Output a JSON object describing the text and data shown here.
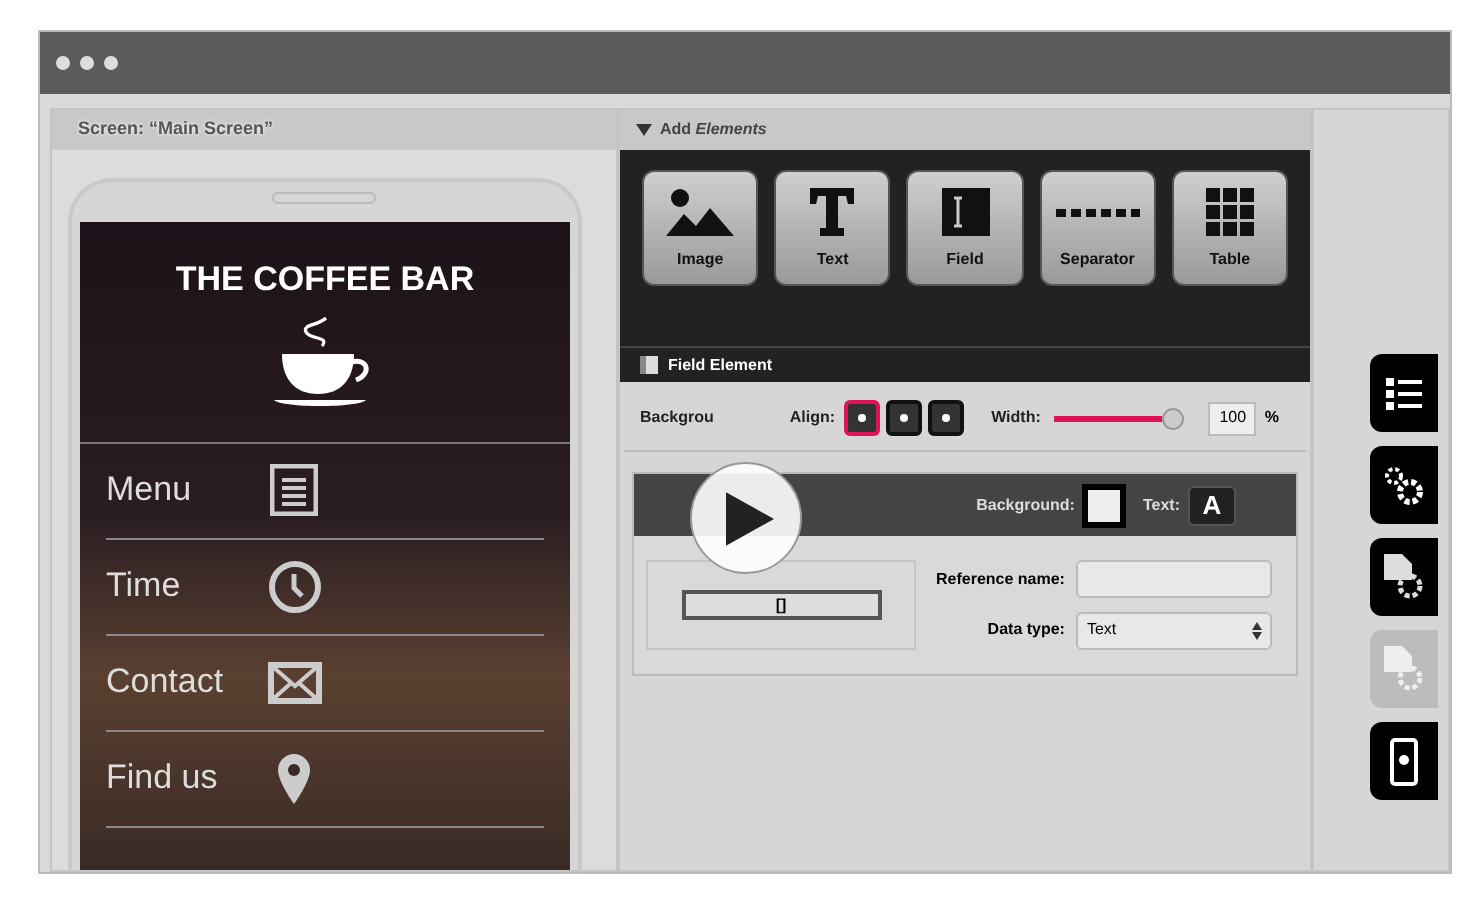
{
  "screen_panel": {
    "title": "Screen: “Main Screen”"
  },
  "phone": {
    "title": "THE COFFEE BAR",
    "menu": [
      {
        "label": "Menu",
        "kind": "list"
      },
      {
        "label": "Time",
        "kind": "clock"
      },
      {
        "label": "Contact",
        "kind": "mail"
      },
      {
        "label": "Find us",
        "kind": "pin"
      }
    ]
  },
  "add_elements": {
    "title": "Add *Elements*",
    "items": [
      {
        "label": "Image",
        "kind": "image"
      },
      {
        "label": "Text",
        "kind": "text"
      },
      {
        "label": "Field",
        "kind": "field"
      },
      {
        "label": "Separator",
        "kind": "separator"
      },
      {
        "label": "Table",
        "kind": "table"
      }
    ]
  },
  "field_element": {
    "title": "Field Element",
    "background_label": "Backgrou",
    "align_label": "Align:",
    "align": [
      {
        "selected": true
      },
      {
        "selected": false
      },
      {
        "selected": false
      }
    ],
    "width_label": "Width:",
    "width": {
      "level": 1,
      "value": "100",
      "unit": "%"
    },
    "style_bar": {
      "background_label": "Background:",
      "text_label": "Text:",
      "text_icon": "A"
    },
    "preview": "[]",
    "reference_label": "Reference name:",
    "data_type_label": "Data type:",
    "data_type": "Text"
  },
  "side_tabs": [
    {
      "kind": "list",
      "disabled": false
    },
    {
      "kind": "gears",
      "disabled": false
    },
    {
      "kind": "doc",
      "disabled": false
    },
    {
      "kind": "table",
      "disabled": true
    },
    {
      "kind": "phone",
      "disabled": false
    }
  ]
}
